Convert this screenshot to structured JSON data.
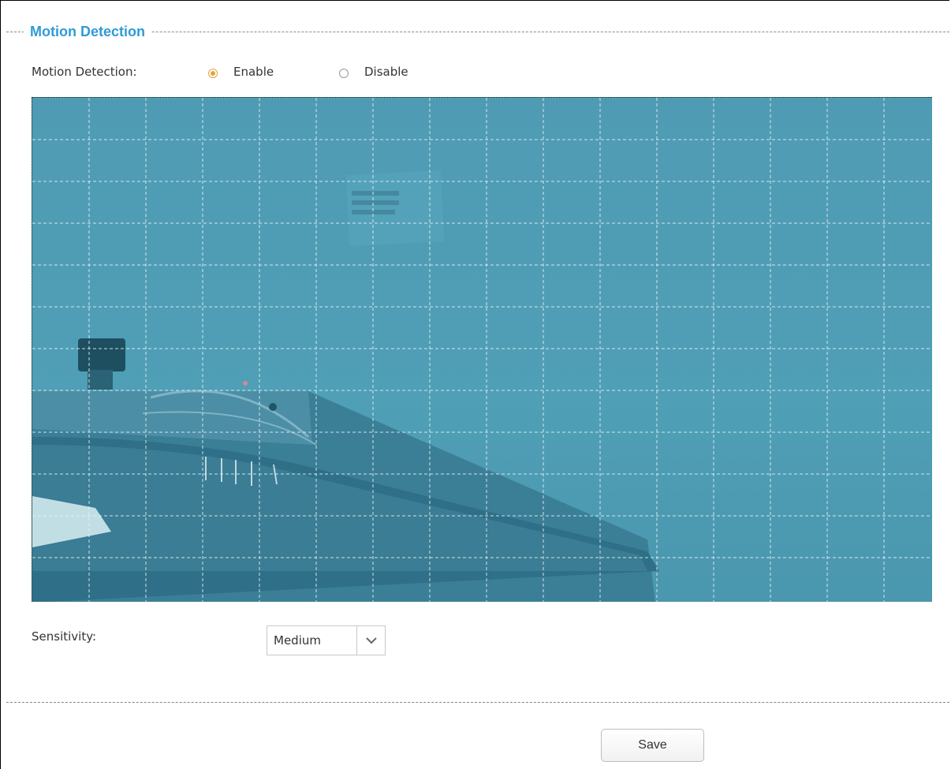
{
  "section": {
    "title": "Motion Detection"
  },
  "motion": {
    "label": "Motion Detection:",
    "options": [
      {
        "label": "Enable",
        "checked": true
      },
      {
        "label": "Disable",
        "checked": false
      }
    ]
  },
  "detection_area": {
    "columns": 16,
    "rows": 12
  },
  "sensitivity": {
    "label": "Sensitivity:",
    "selected": "Medium"
  },
  "actions": {
    "save_label": "Save"
  },
  "colors": {
    "accent": "#2f9bd6",
    "radio_checked": "#e8a23a",
    "overlay": "#4f9bb4"
  }
}
